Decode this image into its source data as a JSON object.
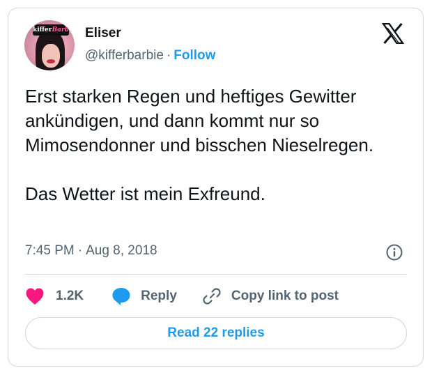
{
  "author": {
    "name": "Eliser",
    "handle": "@kifferbarbie",
    "separator": "·",
    "follow_label": "Follow",
    "avatar_badge": {
      "part1": "kiffer",
      "part2": "Barbie"
    }
  },
  "tweet": {
    "paragraphs": [
      "Erst starken Regen und heftiges Gewitter ankündigen, und dann kommt nur so Mimosendonner und bisschen Nieselregen.",
      "Das Wetter ist mein Exfreund."
    ],
    "time": "7:45 PM",
    "separator": "·",
    "date": "Aug 8, 2018"
  },
  "actions": {
    "like_count": "1.2K",
    "reply_label": "Reply",
    "copy_label": "Copy link to post"
  },
  "read_replies_label": "Read 22 replies",
  "colors": {
    "accent": "#1d9bf0",
    "like": "#f91880",
    "text": "#0f1419",
    "muted": "#536471",
    "border": "#cfd9de"
  },
  "icons": [
    "x-logo-icon",
    "info-icon",
    "heart-icon",
    "reply-bubble-icon",
    "link-icon"
  ]
}
